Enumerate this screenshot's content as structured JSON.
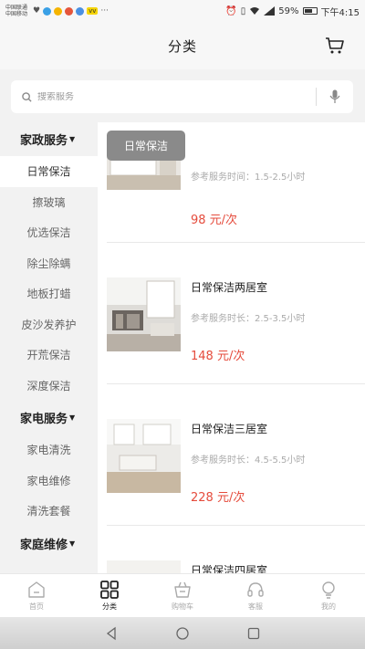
{
  "status_bar": {
    "carrier1": "中国联通",
    "carrier2": "中国移动",
    "left_badge": "vv",
    "more": "···",
    "battery": "59%",
    "time": "下午4:15"
  },
  "header": {
    "title": "分类",
    "cart_icon": "cart-icon"
  },
  "search": {
    "placeholder": "搜索服务"
  },
  "sidebar": {
    "groups": [
      {
        "title": "家政服务",
        "items": [
          "日常保洁",
          "擦玻璃",
          "优选保洁",
          "除尘除螨",
          "地板打蜡",
          "皮沙发养护",
          "开荒保洁",
          "深度保洁"
        ]
      },
      {
        "title": "家电服务",
        "items": [
          "家电清洗",
          "家电维修",
          "清洗套餐"
        ]
      },
      {
        "title": "家庭维修",
        "items": []
      }
    ]
  },
  "content": {
    "section_tag": "日常保洁",
    "products": [
      {
        "name": "",
        "duration": "参考服务时间：1.5-2.5小时",
        "price": "98 元/次"
      },
      {
        "name": "日常保洁两居室",
        "duration": "参考服务时长：2.5-3.5小时",
        "price": "148 元/次"
      },
      {
        "name": "日常保洁三居室",
        "duration": "参考服务时长：4.5-5.5小时",
        "price": "228 元/次"
      },
      {
        "name": "日常保洁四居室",
        "duration": "",
        "price": ""
      }
    ]
  },
  "bottom_nav": [
    {
      "label": "首页",
      "icon": "home-icon"
    },
    {
      "label": "分类",
      "icon": "category-icon"
    },
    {
      "label": "购物车",
      "icon": "shopping-basket-icon"
    },
    {
      "label": "客服",
      "icon": "headset-icon"
    },
    {
      "label": "我的",
      "icon": "profile-icon"
    }
  ],
  "colors": {
    "price": "#e54b3c",
    "section_tag_bg": "#8a8a8a",
    "sidebar_bg": "#f2f2f2"
  }
}
